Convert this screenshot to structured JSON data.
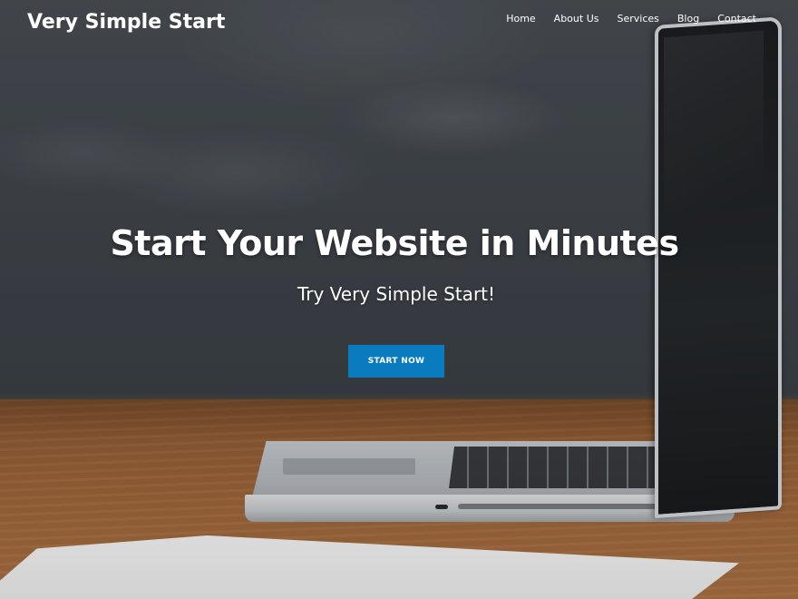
{
  "header": {
    "site_title": "Very Simple Start",
    "nav": [
      {
        "label": "Home"
      },
      {
        "label": "About Us"
      },
      {
        "label": "Services"
      },
      {
        "label": "Blog"
      },
      {
        "label": "Contact"
      }
    ]
  },
  "hero": {
    "title": "Start Your Website in Minutes",
    "subtitle": "Try Very Simple Start!",
    "cta_label": "START NOW"
  },
  "colors": {
    "accent": "#0b7bbf",
    "text": "#ffffff"
  }
}
